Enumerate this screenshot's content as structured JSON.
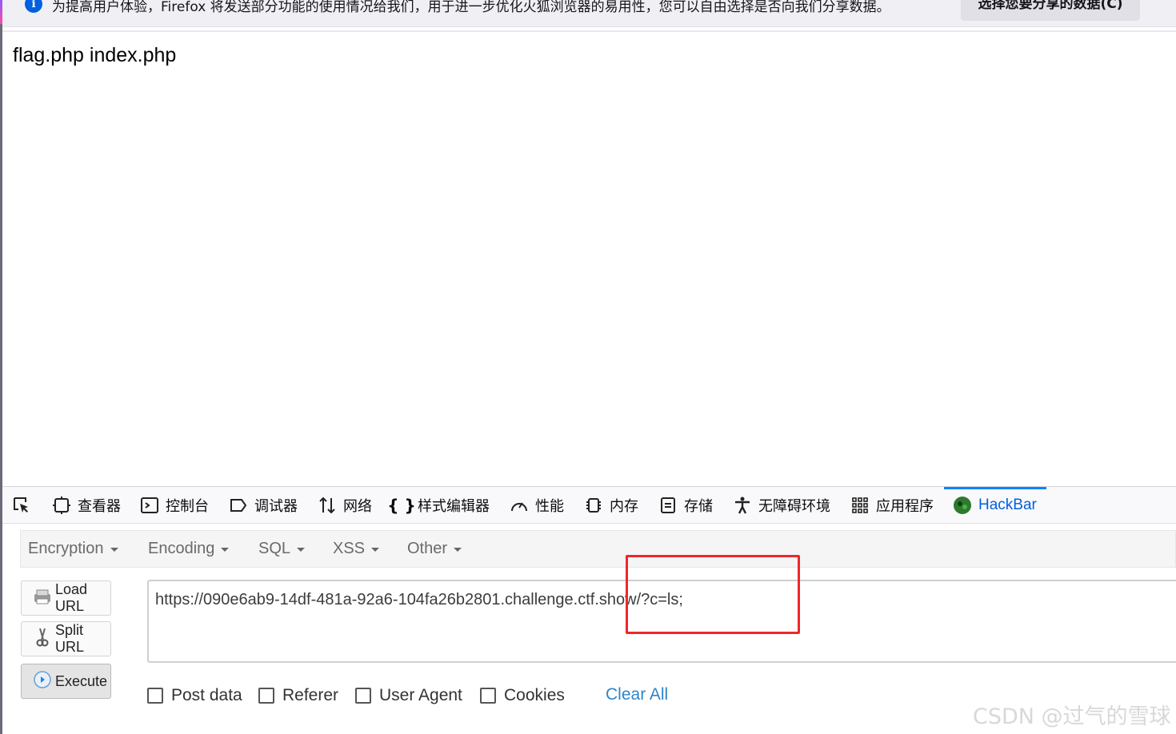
{
  "notification": {
    "text": "为提高用户体验，Firefox 将发送部分功能的使用情况给我们，用于进一步优化火狐浏览器的易用性，您可以自由选择是否向我们分享数据。",
    "button_label": "选择您要分享的数据(C)"
  },
  "page": {
    "output": "flag.php index.php"
  },
  "devtools": {
    "tabs": [
      {
        "label": "",
        "icon": "element-picker-icon"
      },
      {
        "label": "查看器",
        "icon": "inspector-icon"
      },
      {
        "label": "控制台",
        "icon": "console-icon"
      },
      {
        "label": "调试器",
        "icon": "debugger-icon"
      },
      {
        "label": "网络",
        "icon": "network-icon"
      },
      {
        "label": "样式编辑器",
        "icon": "style-editor-icon"
      },
      {
        "label": "性能",
        "icon": "performance-icon"
      },
      {
        "label": "内存",
        "icon": "memory-icon"
      },
      {
        "label": "存储",
        "icon": "storage-icon"
      },
      {
        "label": "无障碍环境",
        "icon": "accessibility-icon"
      },
      {
        "label": "应用程序",
        "icon": "application-icon"
      },
      {
        "label": "HackBar",
        "icon": "hackbar-icon",
        "active": true
      }
    ]
  },
  "hackbar": {
    "menu": [
      "Encryption",
      "Encoding",
      "SQL",
      "XSS",
      "Other"
    ],
    "buttons": {
      "load_url": "Load URL",
      "split_url": "Split URL",
      "execute": "Execute"
    },
    "url": "https://090e6ab9-14df-481a-92a6-104fa26b2801.challenge.ctf.show/?c=ls;",
    "options": [
      "Post data",
      "Referer",
      "User Agent",
      "Cookies"
    ],
    "clear_all": "Clear All"
  },
  "watermark": "CSDN @过气的雪球",
  "colors": {
    "accent": "#0060df",
    "highlight_box": "#f0262b",
    "link": "#2e86c9"
  }
}
